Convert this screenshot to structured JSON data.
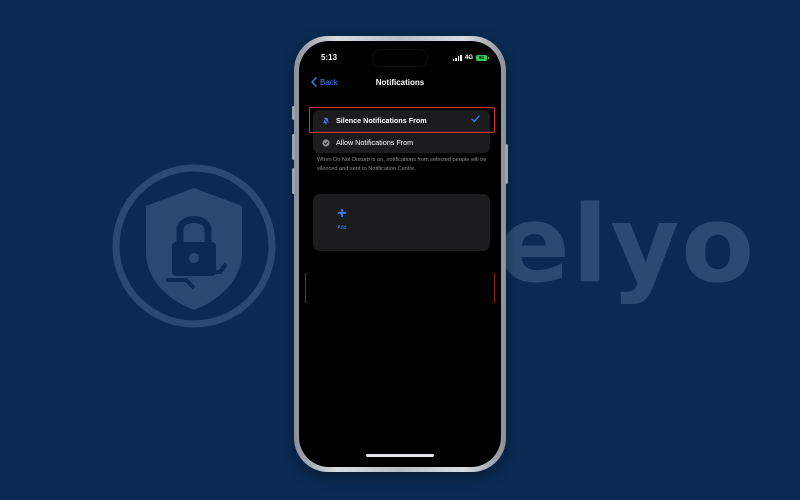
{
  "watermark": {
    "brand_text": "Safelyo"
  },
  "status_bar": {
    "time": "5:13",
    "network": "4G",
    "battery": "84"
  },
  "nav": {
    "back_label": "Back",
    "title": "Notifications"
  },
  "options": {
    "silence_label": "Silence Notifications From",
    "allow_label": "Allow Notifications From",
    "selected": "Silence Notifications From"
  },
  "footnote": "When Do Not Disturb is on, notifications from selected people will be silenced and sent to Notification Centre.",
  "add_tile": {
    "label": "Add"
  },
  "colors": {
    "background": "#0a2a52",
    "accent": "#3a82f7",
    "highlight": "#e02b2b",
    "battery": "#34c759"
  },
  "icons": {
    "back": "chevron-left-icon",
    "silence": "bell-slash-icon",
    "allow": "bell-check-icon",
    "selected": "checkmark-icon",
    "add": "plus-icon"
  }
}
